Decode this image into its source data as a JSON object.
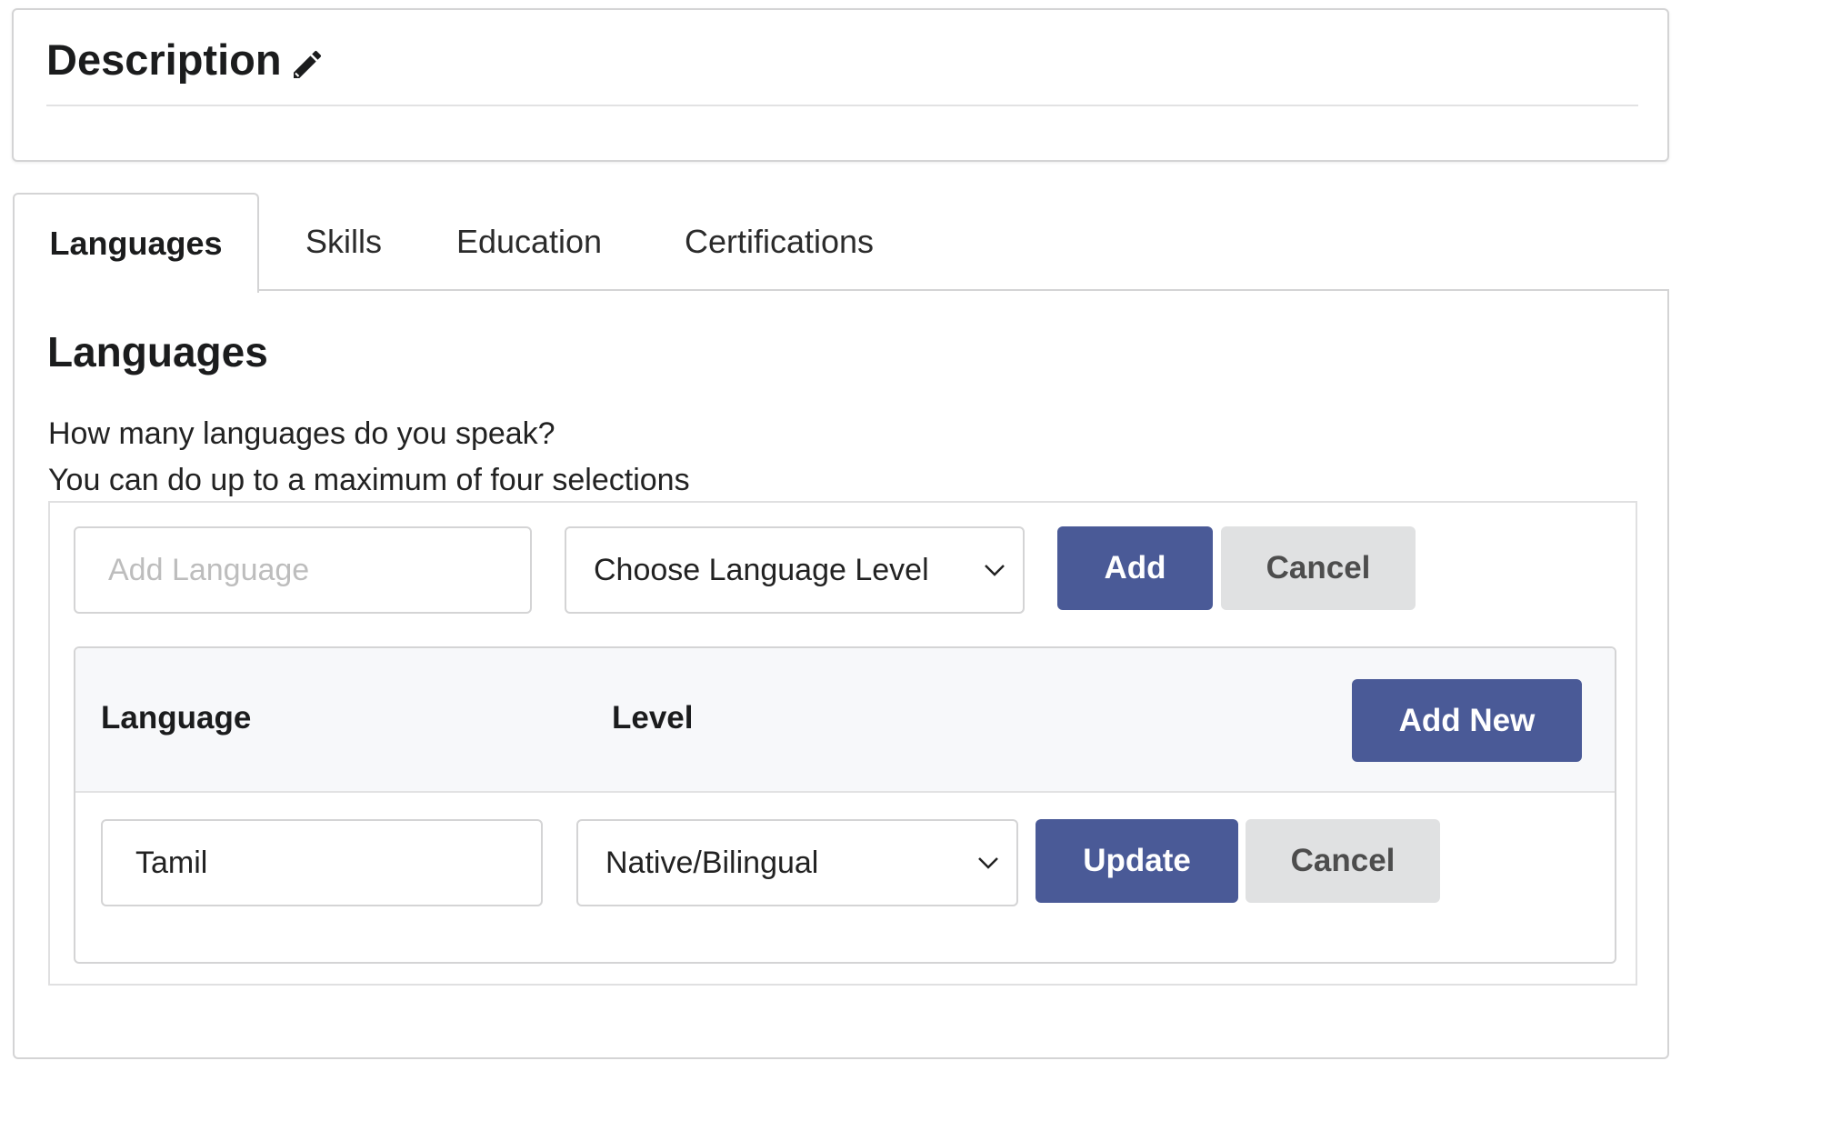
{
  "description": {
    "title": "Description"
  },
  "tabs": [
    {
      "label": "Languages",
      "active": true
    },
    {
      "label": "Skills",
      "active": false
    },
    {
      "label": "Education",
      "active": false
    },
    {
      "label": "Certifications",
      "active": false
    }
  ],
  "languages": {
    "title": "Languages",
    "question": "How many languages do you speak?",
    "hint": "You can do up to a maximum of four selections",
    "add_form": {
      "language_placeholder": "Add Language",
      "level_value": "Choose Language Level",
      "add_label": "Add",
      "cancel_label": "Cancel"
    },
    "table": {
      "headers": {
        "language": "Language",
        "level": "Level"
      },
      "add_new_label": "Add New",
      "rows": [
        {
          "language": "Tamil",
          "level": "Native/Bilingual",
          "update_label": "Update",
          "cancel_label": "Cancel"
        }
      ]
    }
  },
  "colors": {
    "primary": "#4a5a97",
    "secondary": "#e0e1e2",
    "border": "#d4d4d5"
  },
  "icons": {
    "edit": "pencil-icon",
    "dropdown": "chevron-down-icon"
  }
}
